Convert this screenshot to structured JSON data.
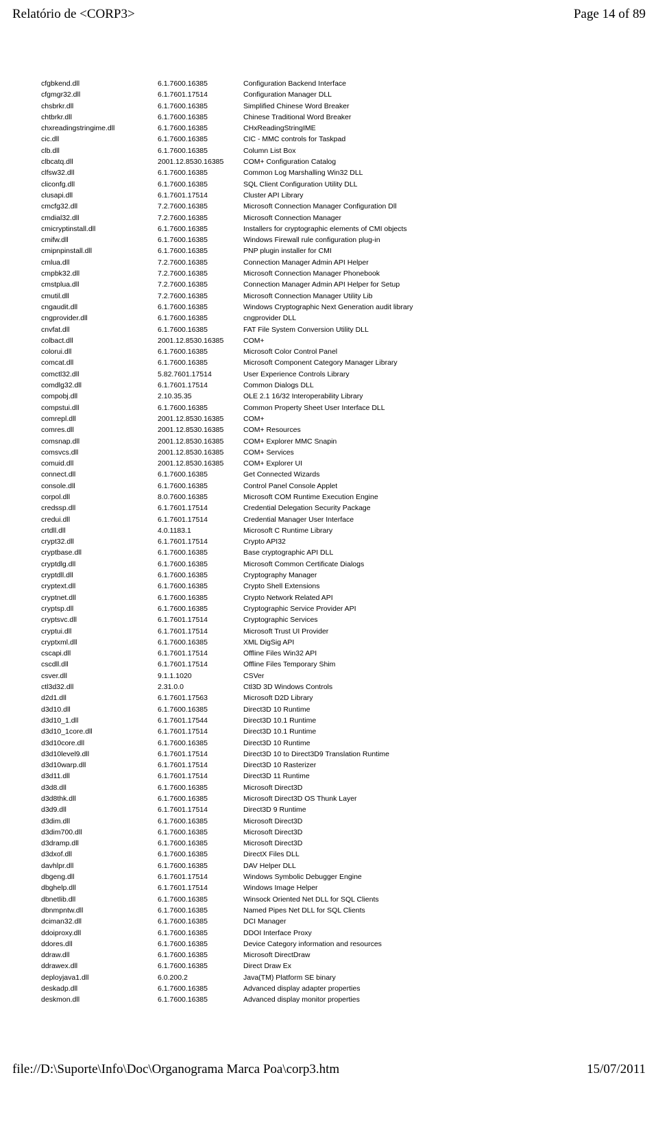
{
  "header": {
    "title": "Relatório de <CORP3>",
    "pageinfo": "Page 14 of 89"
  },
  "footer": {
    "path": "file://D:\\Suporte\\Info\\Doc\\Organograma Marca Poa\\corp3.htm",
    "date": "15/07/2011"
  },
  "rows": [
    {
      "f": "cfgbkend.dll",
      "v": "6.1.7600.16385",
      "d": "Configuration Backend Interface"
    },
    {
      "f": "cfgmgr32.dll",
      "v": "6.1.7601.17514",
      "d": "Configuration Manager DLL"
    },
    {
      "f": "chsbrkr.dll",
      "v": "6.1.7600.16385",
      "d": "Simplified Chinese Word Breaker"
    },
    {
      "f": "chtbrkr.dll",
      "v": "6.1.7600.16385",
      "d": "Chinese Traditional Word Breaker"
    },
    {
      "f": "chxreadingstringime.dll",
      "v": "6.1.7600.16385",
      "d": "CHxReadingStringIME"
    },
    {
      "f": "cic.dll",
      "v": "6.1.7600.16385",
      "d": "CIC - MMC controls for Taskpad"
    },
    {
      "f": "clb.dll",
      "v": "6.1.7600.16385",
      "d": "Column List Box"
    },
    {
      "f": "clbcatq.dll",
      "v": "2001.12.8530.16385",
      "d": "COM+ Configuration Catalog"
    },
    {
      "f": "clfsw32.dll",
      "v": "6.1.7600.16385",
      "d": "Common Log Marshalling Win32 DLL"
    },
    {
      "f": "cliconfg.dll",
      "v": "6.1.7600.16385",
      "d": "SQL Client Configuration Utility DLL"
    },
    {
      "f": "clusapi.dll",
      "v": "6.1.7601.17514",
      "d": "Cluster API Library"
    },
    {
      "f": "cmcfg32.dll",
      "v": "7.2.7600.16385",
      "d": "Microsoft Connection Manager Configuration Dll"
    },
    {
      "f": "cmdial32.dll",
      "v": "7.2.7600.16385",
      "d": "Microsoft Connection Manager"
    },
    {
      "f": "cmicryptinstall.dll",
      "v": "6.1.7600.16385",
      "d": "Installers for cryptographic elements of CMI objects"
    },
    {
      "f": "cmifw.dll",
      "v": "6.1.7600.16385",
      "d": "Windows Firewall rule configuration plug-in"
    },
    {
      "f": "cmipnpinstall.dll",
      "v": "6.1.7600.16385",
      "d": "PNP plugin installer for CMI"
    },
    {
      "f": "cmlua.dll",
      "v": "7.2.7600.16385",
      "d": "Connection Manager Admin API Helper"
    },
    {
      "f": "cmpbk32.dll",
      "v": "7.2.7600.16385",
      "d": "Microsoft Connection Manager Phonebook"
    },
    {
      "f": "cmstplua.dll",
      "v": "7.2.7600.16385",
      "d": "Connection Manager Admin API Helper for Setup"
    },
    {
      "f": "cmutil.dll",
      "v": "7.2.7600.16385",
      "d": "Microsoft Connection Manager Utility Lib"
    },
    {
      "f": "cngaudit.dll",
      "v": "6.1.7600.16385",
      "d": "Windows Cryptographic Next Generation audit library"
    },
    {
      "f": "cngprovider.dll",
      "v": "6.1.7600.16385",
      "d": "cngprovider DLL"
    },
    {
      "f": "cnvfat.dll",
      "v": "6.1.7600.16385",
      "d": "FAT File System Conversion Utility DLL"
    },
    {
      "f": "colbact.dll",
      "v": "2001.12.8530.16385",
      "d": "COM+"
    },
    {
      "f": "colorui.dll",
      "v": "6.1.7600.16385",
      "d": "Microsoft Color Control Panel"
    },
    {
      "f": "comcat.dll",
      "v": "6.1.7600.16385",
      "d": "Microsoft Component Category Manager Library"
    },
    {
      "f": "comctl32.dll",
      "v": "5.82.7601.17514",
      "d": "User Experience Controls Library"
    },
    {
      "f": "comdlg32.dll",
      "v": "6.1.7601.17514",
      "d": "Common Dialogs DLL"
    },
    {
      "f": "compobj.dll",
      "v": "2.10.35.35",
      "d": "OLE 2.1 16/32 Interoperability Library"
    },
    {
      "f": "compstui.dll",
      "v": "6.1.7600.16385",
      "d": "Common Property Sheet User Interface DLL"
    },
    {
      "f": "comrepl.dll",
      "v": "2001.12.8530.16385",
      "d": "COM+"
    },
    {
      "f": "comres.dll",
      "v": "2001.12.8530.16385",
      "d": "COM+ Resources"
    },
    {
      "f": "comsnap.dll",
      "v": "2001.12.8530.16385",
      "d": "COM+ Explorer MMC Snapin"
    },
    {
      "f": "comsvcs.dll",
      "v": "2001.12.8530.16385",
      "d": "COM+ Services"
    },
    {
      "f": "comuid.dll",
      "v": "2001.12.8530.16385",
      "d": "COM+ Explorer UI"
    },
    {
      "f": "connect.dll",
      "v": "6.1.7600.16385",
      "d": "Get Connected Wizards"
    },
    {
      "f": "console.dll",
      "v": "6.1.7600.16385",
      "d": "Control Panel Console Applet"
    },
    {
      "f": "corpol.dll",
      "v": "8.0.7600.16385",
      "d": "Microsoft COM Runtime Execution Engine"
    },
    {
      "f": "credssp.dll",
      "v": "6.1.7601.17514",
      "d": "Credential Delegation Security Package"
    },
    {
      "f": "credui.dll",
      "v": "6.1.7601.17514",
      "d": "Credential Manager User Interface"
    },
    {
      "f": "crtdll.dll",
      "v": "4.0.1183.1",
      "d": "Microsoft C Runtime Library"
    },
    {
      "f": "crypt32.dll",
      "v": "6.1.7601.17514",
      "d": "Crypto API32"
    },
    {
      "f": "cryptbase.dll",
      "v": "6.1.7600.16385",
      "d": "Base cryptographic API DLL"
    },
    {
      "f": "cryptdlg.dll",
      "v": "6.1.7600.16385",
      "d": "Microsoft Common Certificate Dialogs"
    },
    {
      "f": "cryptdll.dll",
      "v": "6.1.7600.16385",
      "d": "Cryptography Manager"
    },
    {
      "f": "cryptext.dll",
      "v": "6.1.7600.16385",
      "d": "Crypto Shell Extensions"
    },
    {
      "f": "cryptnet.dll",
      "v": "6.1.7600.16385",
      "d": "Crypto Network Related API"
    },
    {
      "f": "cryptsp.dll",
      "v": "6.1.7600.16385",
      "d": "Cryptographic Service Provider API"
    },
    {
      "f": "cryptsvc.dll",
      "v": "6.1.7601.17514",
      "d": "Cryptographic Services"
    },
    {
      "f": "cryptui.dll",
      "v": "6.1.7601.17514",
      "d": "Microsoft Trust UI Provider"
    },
    {
      "f": "cryptxml.dll",
      "v": "6.1.7600.16385",
      "d": "XML DigSig API"
    },
    {
      "f": "cscapi.dll",
      "v": "6.1.7601.17514",
      "d": "Offline Files Win32 API"
    },
    {
      "f": "cscdll.dll",
      "v": "6.1.7601.17514",
      "d": "Offline Files Temporary Shim"
    },
    {
      "f": "csver.dll",
      "v": "9.1.1.1020",
      "d": "CSVer"
    },
    {
      "f": "ctl3d32.dll",
      "v": "2.31.0.0",
      "d": "Ctl3D 3D Windows Controls"
    },
    {
      "f": "d2d1.dll",
      "v": "6.1.7601.17563",
      "d": "Microsoft D2D Library"
    },
    {
      "f": "d3d10.dll",
      "v": "6.1.7600.16385",
      "d": "Direct3D 10 Runtime"
    },
    {
      "f": "d3d10_1.dll",
      "v": "6.1.7601.17544",
      "d": "Direct3D 10.1 Runtime"
    },
    {
      "f": "d3d10_1core.dll",
      "v": "6.1.7601.17514",
      "d": "Direct3D 10.1 Runtime"
    },
    {
      "f": "d3d10core.dll",
      "v": "6.1.7600.16385",
      "d": "Direct3D 10 Runtime"
    },
    {
      "f": "d3d10level9.dll",
      "v": "6.1.7601.17514",
      "d": "Direct3D 10 to Direct3D9 Translation Runtime"
    },
    {
      "f": "d3d10warp.dll",
      "v": "6.1.7601.17514",
      "d": "Direct3D 10 Rasterizer"
    },
    {
      "f": "d3d11.dll",
      "v": "6.1.7601.17514",
      "d": "Direct3D 11 Runtime"
    },
    {
      "f": "d3d8.dll",
      "v": "6.1.7600.16385",
      "d": "Microsoft Direct3D"
    },
    {
      "f": "d3d8thk.dll",
      "v": "6.1.7600.16385",
      "d": "Microsoft Direct3D OS Thunk Layer"
    },
    {
      "f": "d3d9.dll",
      "v": "6.1.7601.17514",
      "d": "Direct3D 9 Runtime"
    },
    {
      "f": "d3dim.dll",
      "v": "6.1.7600.16385",
      "d": "Microsoft Direct3D"
    },
    {
      "f": "d3dim700.dll",
      "v": "6.1.7600.16385",
      "d": "Microsoft Direct3D"
    },
    {
      "f": "d3dramp.dll",
      "v": "6.1.7600.16385",
      "d": "Microsoft Direct3D"
    },
    {
      "f": "d3dxof.dll",
      "v": "6.1.7600.16385",
      "d": "DirectX Files DLL"
    },
    {
      "f": "davhlpr.dll",
      "v": "6.1.7600.16385",
      "d": "DAV Helper DLL"
    },
    {
      "f": "dbgeng.dll",
      "v": "6.1.7601.17514",
      "d": "Windows Symbolic Debugger Engine"
    },
    {
      "f": "dbghelp.dll",
      "v": "6.1.7601.17514",
      "d": "Windows Image Helper"
    },
    {
      "f": "dbnetlib.dll",
      "v": "6.1.7600.16385",
      "d": "Winsock Oriented Net DLL for SQL Clients"
    },
    {
      "f": "dbnmpntw.dll",
      "v": "6.1.7600.16385",
      "d": "Named Pipes Net DLL for SQL Clients"
    },
    {
      "f": "dciman32.dll",
      "v": "6.1.7600.16385",
      "d": "DCI Manager"
    },
    {
      "f": "ddoiproxy.dll",
      "v": "6.1.7600.16385",
      "d": "DDOI Interface Proxy"
    },
    {
      "f": "ddores.dll",
      "v": "6.1.7600.16385",
      "d": "Device Category information and resources"
    },
    {
      "f": "ddraw.dll",
      "v": "6.1.7600.16385",
      "d": "Microsoft DirectDraw"
    },
    {
      "f": "ddrawex.dll",
      "v": "6.1.7600.16385",
      "d": "Direct Draw Ex"
    },
    {
      "f": "deployjava1.dll",
      "v": "6.0.200.2",
      "d": "Java(TM) Platform SE binary"
    },
    {
      "f": "deskadp.dll",
      "v": "6.1.7600.16385",
      "d": "Advanced display adapter properties"
    },
    {
      "f": "deskmon.dll",
      "v": "6.1.7600.16385",
      "d": "Advanced display monitor properties"
    }
  ]
}
